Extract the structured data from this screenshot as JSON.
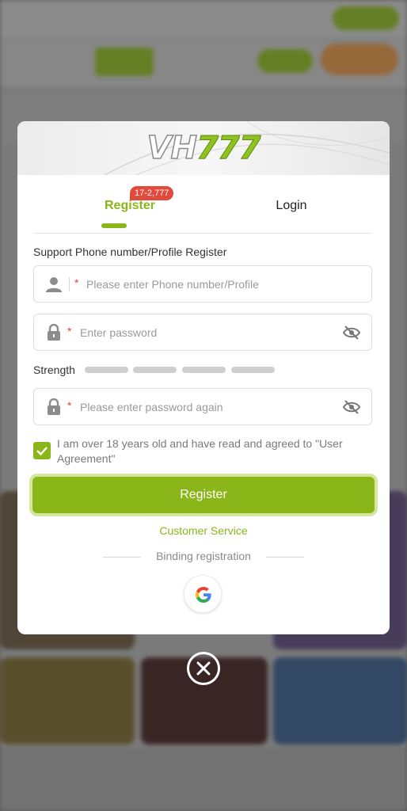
{
  "brand": {
    "logo_letters": "VH",
    "logo_number": "777",
    "accent_color": "#8ab61a",
    "badge_color": "#e24a3b"
  },
  "tabs": {
    "register_label": "Register",
    "register_badge": "17-2,777",
    "login_label": "Login",
    "active": "Register"
  },
  "form": {
    "section_label": "Support Phone number/Profile Register",
    "phone": {
      "placeholder": "Please enter Phone number/Profile",
      "icon": "user-icon",
      "required_mark": "*"
    },
    "password": {
      "placeholder": "Enter password",
      "icon": "lock-icon",
      "required_mark": "*",
      "toggle_icon": "eye-off-icon"
    },
    "strength_label": "Strength",
    "strength_levels": 4,
    "confirm_password": {
      "placeholder": "Please enter password again",
      "icon": "lock-icon",
      "required_mark": "*",
      "toggle_icon": "eye-off-icon"
    },
    "agreement": {
      "checked": true,
      "text": "I am over 18 years old and have read and agreed to \"User Agreement\""
    },
    "submit_label": "Register"
  },
  "customer_service_label": "Customer Service",
  "binding": {
    "label": "Binding registration",
    "providers": [
      "google-icon"
    ]
  },
  "close_icon": "close-circle-icon"
}
